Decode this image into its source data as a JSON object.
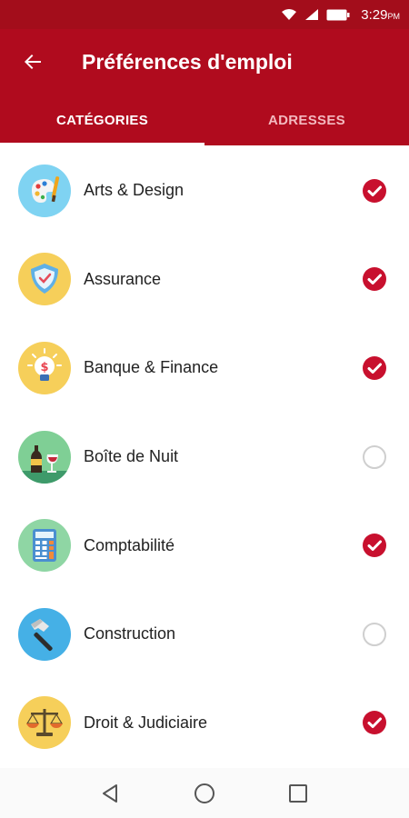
{
  "status": {
    "time": "3:29",
    "ampm": "PM"
  },
  "appbar": {
    "title": "Préférences d'emploi"
  },
  "tabs": [
    {
      "label": "CATÉGORIES",
      "active": true
    },
    {
      "label": "ADRESSES",
      "active": false
    }
  ],
  "categories": [
    {
      "label": "Arts & Design",
      "icon": "palette-icon",
      "checked": true
    },
    {
      "label": "Assurance",
      "icon": "shield-icon",
      "checked": true
    },
    {
      "label": "Banque & Finance",
      "icon": "dollar-bulb-icon",
      "checked": true
    },
    {
      "label": "Boîte de Nuit",
      "icon": "wine-icon",
      "checked": false
    },
    {
      "label": "Comptabilité",
      "icon": "calculator-icon",
      "checked": true
    },
    {
      "label": "Construction",
      "icon": "hammer-icon",
      "checked": false
    },
    {
      "label": "Droit & Judiciaire",
      "icon": "scales-icon",
      "checked": true
    }
  ],
  "colors": {
    "primary": "#b00b1e",
    "check": "#c8102e"
  }
}
